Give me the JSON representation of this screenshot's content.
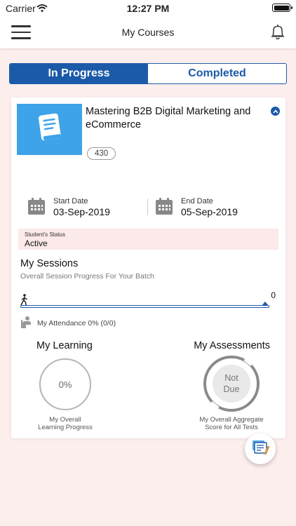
{
  "status_bar": {
    "carrier": "Carrier",
    "time": "12:27 PM"
  },
  "header": {
    "title": "My Courses",
    "menu_icon": "hamburger-menu-icon",
    "notification_icon": "bell-icon"
  },
  "tabs": [
    {
      "label": "In Progress",
      "active": true
    },
    {
      "label": "Completed",
      "active": false
    }
  ],
  "course": {
    "title": "Mastering B2B Digital Marketing and eCommerce",
    "code": "430",
    "thumbnail_icon": "book-icon",
    "thumbnail_color": "#3ea3e8",
    "start_date_label": "Start Date",
    "start_date": "03-Sep-2019",
    "end_date_label": "End Date",
    "end_date": "05-Sep-2019",
    "status_label": "Student's Status",
    "status": "Active"
  },
  "sessions": {
    "title": "My Sessions",
    "subtitle": "Overall Session Progress For Your Batch",
    "progress_count": "0",
    "progress_fraction": 0,
    "attendance_text": "My Attendance 0% (0/0)"
  },
  "learning": {
    "title": "My Learning",
    "value": "0%",
    "caption_line1": "My Overall",
    "caption_line2": "Learning Progress"
  },
  "assessments": {
    "title": "My Assessments",
    "value_line1": "Not",
    "value_line2": "Due",
    "caption_line1": "My Overall Aggregate",
    "caption_line2": "Score for All Tests"
  },
  "colors": {
    "accent": "#1b5aa8",
    "background": "#fdeeee",
    "status_bg": "#fce9e9"
  }
}
